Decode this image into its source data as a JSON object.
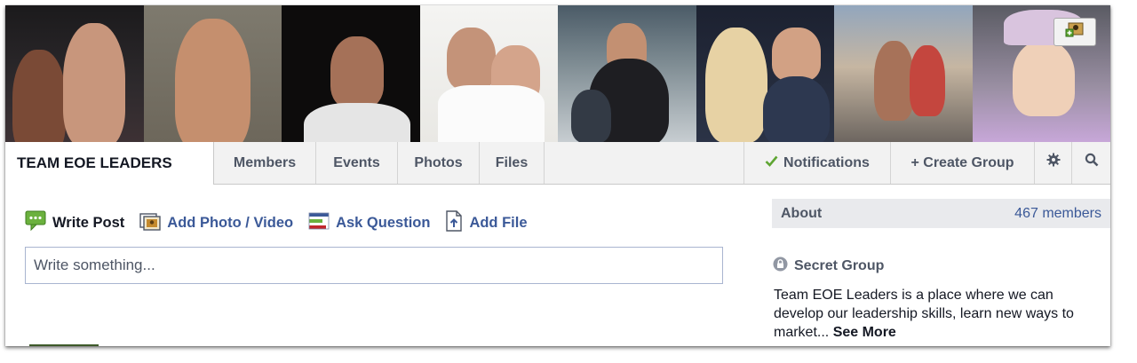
{
  "group": {
    "name": "TEAM EOE LEADERS"
  },
  "tabs": [
    {
      "label": "Members"
    },
    {
      "label": "Events"
    },
    {
      "label": "Photos"
    },
    {
      "label": "Files"
    }
  ],
  "header_actions": {
    "notifications": "Notifications",
    "create_group": "+ Create Group"
  },
  "composer": {
    "write_post": "Write Post",
    "add_photo": "Add Photo / Video",
    "ask_question": "Ask Question",
    "add_file": "Add File",
    "placeholder": "Write something..."
  },
  "about": {
    "title": "About",
    "members": "467 members",
    "privacy": "Secret Group",
    "description": "Team EOE Leaders is a place where we can develop our leadership skills, learn new ways to market...",
    "see_more": "See More"
  },
  "icons": {
    "add_photo_cover": "add-cover-photo-icon",
    "check": "check-icon",
    "gear": "gear-icon",
    "search": "search-icon",
    "lock": "lock-icon"
  },
  "colors": {
    "link": "#3b5998",
    "nav_bg": "#f2f2f2",
    "check": "#5ea532"
  }
}
